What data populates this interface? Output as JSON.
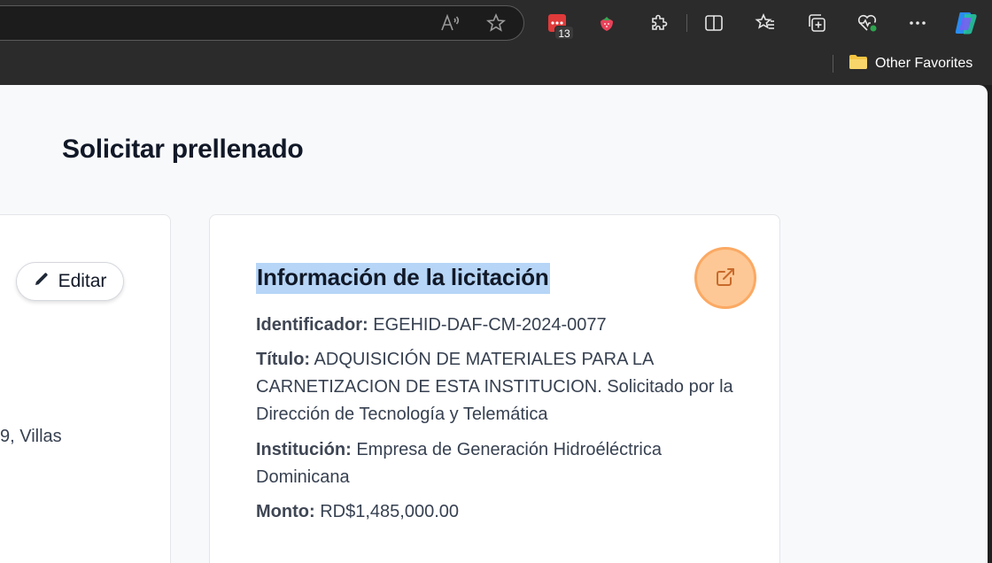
{
  "browser": {
    "extension_badge": "13",
    "favorites": {
      "label": "Other Favorites"
    }
  },
  "page": {
    "title": "Solicitar prellenado",
    "left_card": {
      "edit_label": "Editar",
      "partial_text": "9, Villas"
    },
    "tender_card": {
      "title": "Información de la licitación",
      "fields": [
        {
          "label": "Identificador:",
          "value": "EGEHID-DAF-CM-2024-0077"
        },
        {
          "label": "Título:",
          "value": "ADQUISICIÓN DE MATERIALES PARA LA CARNETIZACION DE ESTA INSTITUCION. Solicitado por la Dirección de Tecnología y Telemática"
        },
        {
          "label": "Institución:",
          "value": "Empresa de Generación Hidroéléctrica Dominicana"
        },
        {
          "label": "Monto:",
          "value": "RD$1,485,000.00"
        }
      ]
    }
  },
  "colors": {
    "accent_button_fill": "#fdc895",
    "accent_button_border": "#fba963",
    "selection_highlight": "#b6d5f7"
  }
}
